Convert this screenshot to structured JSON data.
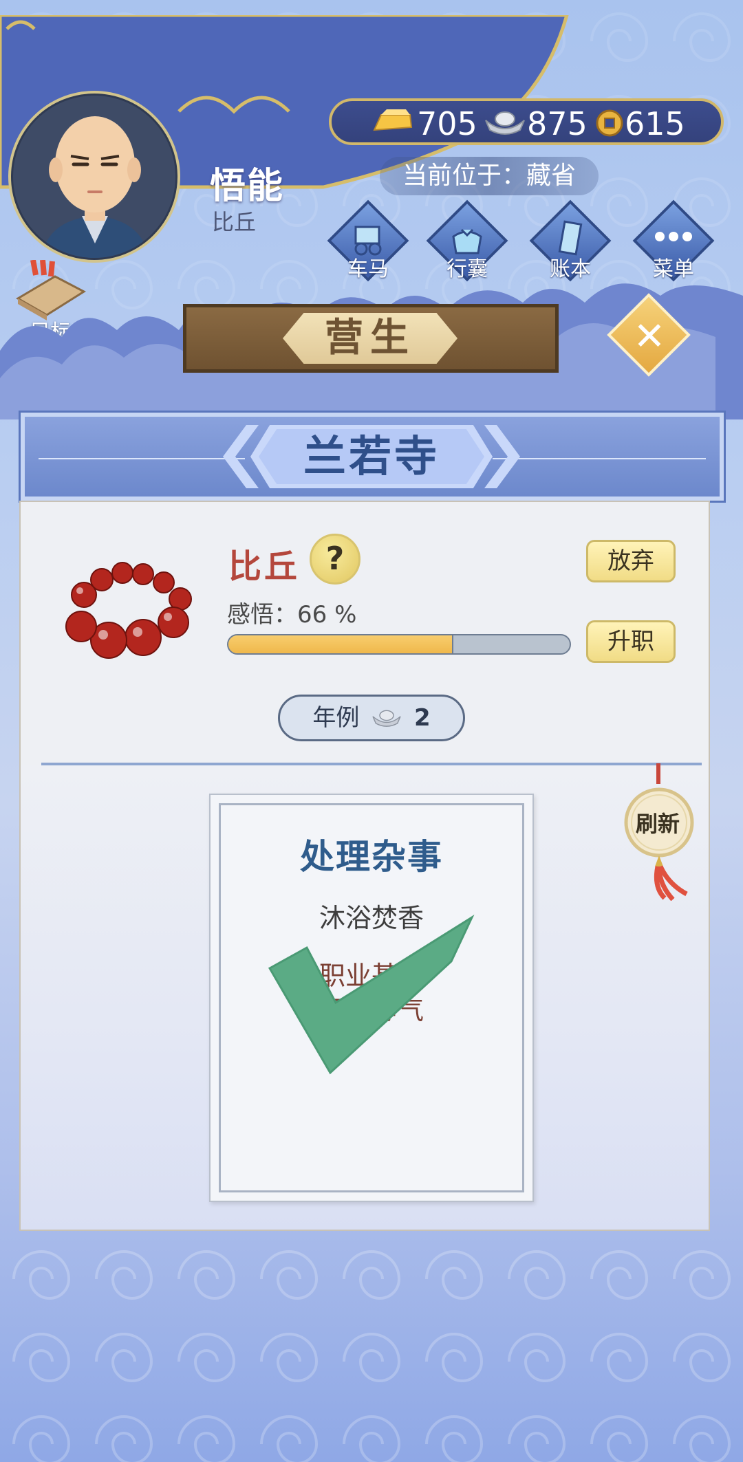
{
  "player": {
    "name": "悟能",
    "rank": "比丘"
  },
  "currency": {
    "gold": "705",
    "silver": "875",
    "coin": "615"
  },
  "location": "当前位于：藏省",
  "nav": [
    {
      "label": "车马",
      "icon": "carriage-icon"
    },
    {
      "label": "行囊",
      "icon": "bundle-icon"
    },
    {
      "label": "账本",
      "icon": "ledger-icon"
    },
    {
      "label": "菜单",
      "icon": "more-icon"
    }
  ],
  "target_label": "目标",
  "page_title": "营生",
  "temple": "兰若寺",
  "job": {
    "rank_title": "比丘",
    "help": "?",
    "insight_label": "感悟：66 %",
    "insight_progress": 0.66,
    "abandon": "放弃",
    "promote": "升职",
    "salary_label": "年例",
    "salary_value": "2"
  },
  "refresh_label": "刷新",
  "task": {
    "title": "处理杂事",
    "subtitle": "沐浴焚香",
    "desc_line1": "职业基础",
    "desc_line2": "平心静气",
    "completed": true
  },
  "colors": {
    "accent": "#2f5c8c",
    "rank": "#b4473c",
    "progress": "#efb84c",
    "check": "#5bab85"
  }
}
